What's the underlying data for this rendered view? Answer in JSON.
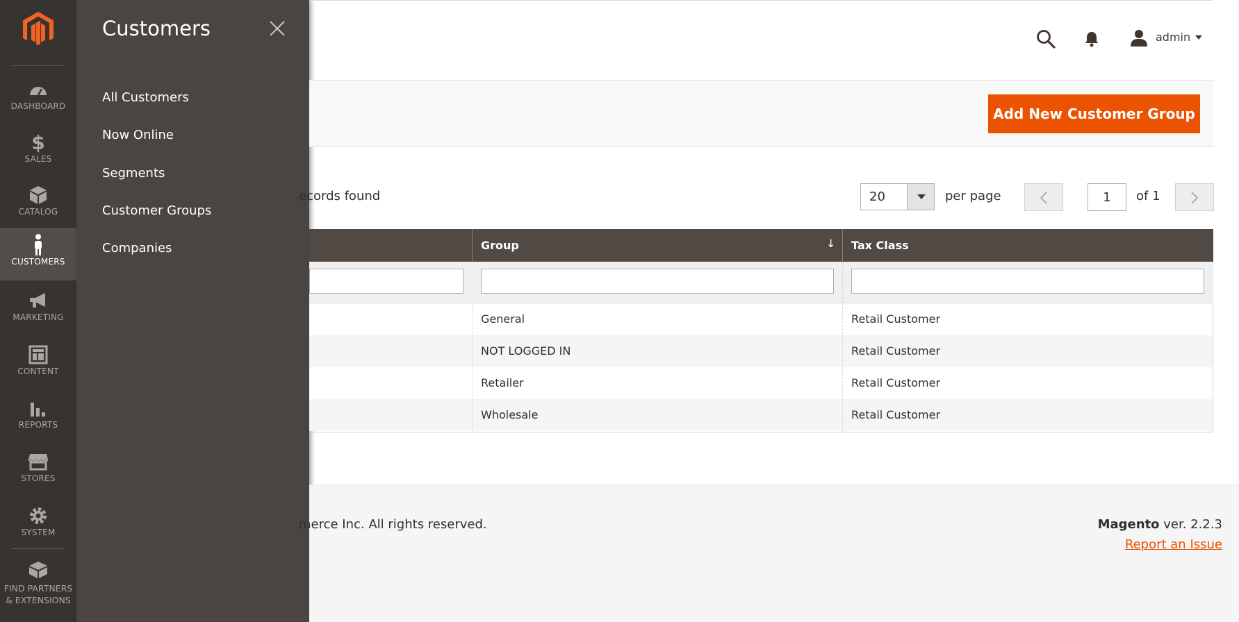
{
  "nav": {
    "items": [
      {
        "label": "DASHBOARD",
        "icon": "dashboard-icon"
      },
      {
        "label": "SALES",
        "icon": "dollar-icon"
      },
      {
        "label": "CATALOG",
        "icon": "box-icon"
      },
      {
        "label": "CUSTOMERS",
        "icon": "person-icon"
      },
      {
        "label": "MARKETING",
        "icon": "megaphone-icon"
      },
      {
        "label": "CONTENT",
        "icon": "layout-icon"
      },
      {
        "label": "REPORTS",
        "icon": "bar-chart-icon"
      },
      {
        "label": "STORES",
        "icon": "storefront-icon"
      },
      {
        "label": "SYSTEM",
        "icon": "gear-icon"
      },
      {
        "label": "FIND PARTNERS & EXTENSIONS",
        "icon": "blocks-icon"
      }
    ],
    "active": "CUSTOMERS"
  },
  "flyout": {
    "title": "Customers",
    "items": [
      "All Customers",
      "Now Online",
      "Segments",
      "Customer Groups",
      "Companies"
    ]
  },
  "header": {
    "user": "admin"
  },
  "actions": {
    "add_label": "Add New Customer Group"
  },
  "toolbar": {
    "records_text": "ecords found",
    "per_page_value": "20",
    "per_page_label": "per page",
    "page_value": "1",
    "page_of": "of 1"
  },
  "grid": {
    "columns": [
      "Group",
      "Tax Class"
    ],
    "rows": [
      {
        "group": "General",
        "tax_class": "Retail Customer"
      },
      {
        "group": "NOT LOGGED IN",
        "tax_class": "Retail Customer"
      },
      {
        "group": "Retailer",
        "tax_class": "Retail Customer"
      },
      {
        "group": "Wholesale",
        "tax_class": "Retail Customer"
      }
    ]
  },
  "footer": {
    "copyright": "merce Inc. All rights reserved.",
    "brand": "Magento",
    "version": " ver. 2.2.3",
    "report_link": "Report an Issue"
  },
  "colors": {
    "accent": "#eb5202",
    "nav_bg": "#373330",
    "flyout_bg": "#4a4542",
    "grid_header": "#514943"
  }
}
